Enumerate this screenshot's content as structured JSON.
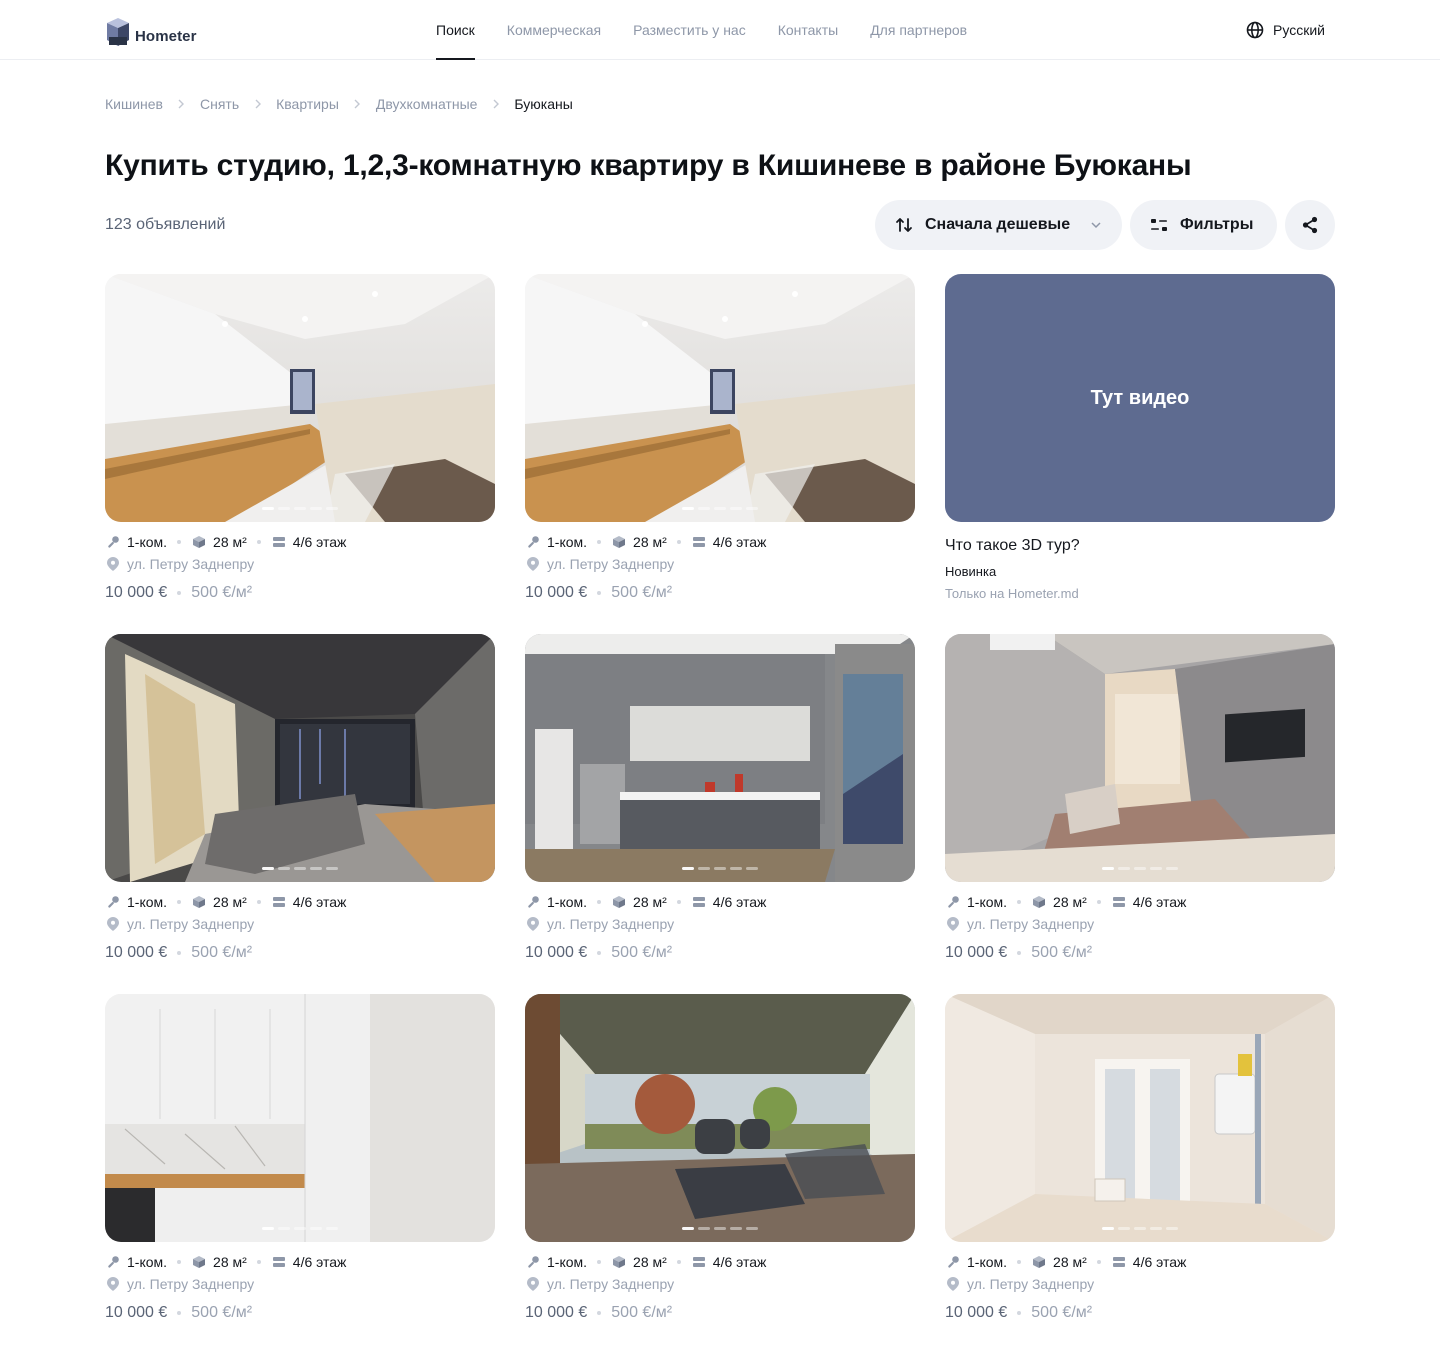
{
  "header": {
    "logo_text": "Hometer",
    "nav": [
      {
        "label": "Поиск",
        "active": true
      },
      {
        "label": "Коммерческая",
        "active": false
      },
      {
        "label": "Разместить у нас",
        "active": false
      },
      {
        "label": "Контакты",
        "active": false
      },
      {
        "label": "Для партнеров",
        "active": false
      }
    ],
    "language": "Русский",
    "language_icon": "globe-icon"
  },
  "breadcrumb": [
    "Кишинев",
    "Снять",
    "Квартиры",
    "Двухкомнатные",
    "Буюканы"
  ],
  "page_title": "Купить студию, 1,2,3-комнатную квартиру в Кишиневе в районе Буюканы",
  "listing_count": "123 объявлений",
  "toolbar": {
    "sort_label": "Сначала дешевые",
    "sort_icon": "sort-arrows-icon",
    "filters_label": "Фильтры",
    "filters_icon": "sliders-icon",
    "share_icon": "share-icon"
  },
  "promo": {
    "video_label": "Тут видео",
    "title": "Что такое 3D тур?",
    "subtitle": "Новинка",
    "note": "Только на Hometer.md"
  },
  "listings": [
    {
      "scene": "kitchen-white",
      "rooms": "1-ком.",
      "area": "28 м²",
      "floor": "4/6 этаж",
      "address": "ул. Петру Заднепру",
      "price": "10 000 €",
      "price_per_m2": "500 €/м²",
      "photo_count": 5,
      "active_photo": 1
    },
    {
      "scene": "kitchen-white",
      "rooms": "1-ком.",
      "area": "28 м²",
      "floor": "4/6 этаж",
      "address": "ул. Петру Заднепру",
      "price": "10 000 €",
      "price_per_m2": "500 €/м²",
      "photo_count": 5,
      "active_photo": 1
    },
    {
      "scene": "living-dark",
      "rooms": "1-ком.",
      "area": "28 м²",
      "floor": "4/6 этаж",
      "address": "ул. Петру Заднепру",
      "price": "10 000 €",
      "price_per_m2": "500 €/м²",
      "photo_count": 5,
      "active_photo": 1
    },
    {
      "scene": "kitchen-grey",
      "rooms": "1-ком.",
      "area": "28 м²",
      "floor": "4/6 этаж",
      "address": "ул. Петру Заднепру",
      "price": "10 000 €",
      "price_per_m2": "500 €/м²",
      "photo_count": 5,
      "active_photo": 1
    },
    {
      "scene": "bedroom",
      "rooms": "1-ком.",
      "area": "28 м²",
      "floor": "4/6 этаж",
      "address": "ул. Петру Заднепру",
      "price": "10 000 €",
      "price_per_m2": "500 €/м²",
      "photo_count": 5,
      "active_photo": 1
    },
    {
      "scene": "kitchen-marble",
      "rooms": "1-ком.",
      "area": "28 м²",
      "floor": "4/6 этаж",
      "address": "ул. Петру Заднепру",
      "price": "10 000 €",
      "price_per_m2": "500 €/м²",
      "photo_count": 5,
      "active_photo": 1
    },
    {
      "scene": "terrace",
      "rooms": "1-ком.",
      "area": "28 м²",
      "floor": "4/6 этаж",
      "address": "ул. Петру Заднепру",
      "price": "10 000 €",
      "price_per_m2": "500 €/м²",
      "photo_count": 5,
      "active_photo": 1
    },
    {
      "scene": "unfinished-room",
      "rooms": "1-ком.",
      "area": "28 м²",
      "floor": "4/6 этаж",
      "address": "ул. Петру Заднепру",
      "price": "10 000 €",
      "price_per_m2": "500 €/м²",
      "photo_count": 5,
      "active_photo": 1
    }
  ]
}
